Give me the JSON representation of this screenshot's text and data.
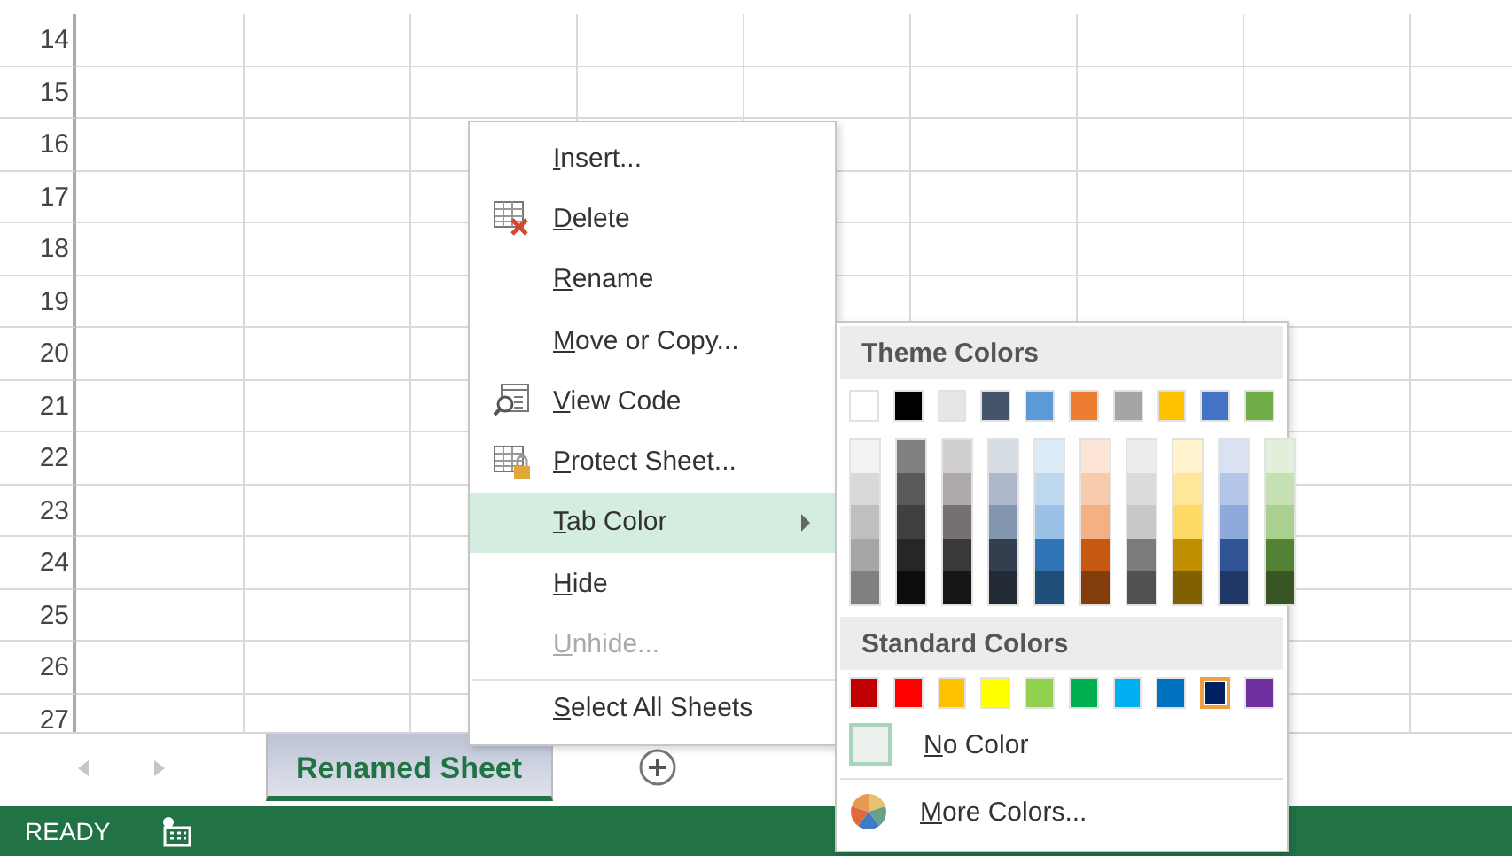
{
  "sheet": {
    "row_numbers": [
      "14",
      "15",
      "16",
      "17",
      "18",
      "19",
      "20",
      "21",
      "22",
      "23",
      "24",
      "25",
      "26",
      "27"
    ]
  },
  "context_menu": {
    "items": [
      {
        "label": "Insert...",
        "kind": "plain",
        "disabled": false,
        "selected": false,
        "separator_before": false
      },
      {
        "label": "Delete",
        "kind": "delete",
        "disabled": false,
        "selected": false,
        "separator_before": false
      },
      {
        "label": "Rename",
        "kind": "plain",
        "disabled": false,
        "selected": false,
        "separator_before": false
      },
      {
        "label": "Move or Copy...",
        "kind": "plain",
        "disabled": false,
        "selected": false,
        "separator_before": false
      },
      {
        "label": "View Code",
        "kind": "code",
        "disabled": false,
        "selected": false,
        "separator_before": false
      },
      {
        "label": "Protect Sheet...",
        "kind": "protect",
        "disabled": false,
        "selected": false,
        "separator_before": false
      },
      {
        "label": "Tab Color",
        "kind": "submenu",
        "disabled": false,
        "selected": true,
        "separator_before": false
      },
      {
        "label": "Hide",
        "kind": "plain",
        "disabled": false,
        "selected": false,
        "separator_before": false
      },
      {
        "label": "Unhide...",
        "kind": "plain",
        "disabled": true,
        "selected": false,
        "separator_before": false
      },
      {
        "label": "Select All Sheets",
        "kind": "plain",
        "disabled": false,
        "selected": false,
        "separator_before": true
      }
    ]
  },
  "color_menu": {
    "theme_title": "Theme Colors",
    "theme_colors": [
      {
        "color": "#ffffff",
        "shades": [
          {
            "color": "#f2f2f2"
          },
          {
            "color": "#d9d9d9"
          },
          {
            "color": "#bfbfbf"
          },
          {
            "color": "#a6a6a6"
          },
          {
            "color": "#808080"
          }
        ]
      },
      {
        "color": "#000000",
        "shades": [
          {
            "color": "#808080"
          },
          {
            "color": "#595959"
          },
          {
            "color": "#404040"
          },
          {
            "color": "#262626"
          },
          {
            "color": "#0d0d0d"
          }
        ]
      },
      {
        "color": "#e7e6e6",
        "shades": [
          {
            "color": "#d0cece"
          },
          {
            "color": "#aeaaaa"
          },
          {
            "color": "#757171"
          },
          {
            "color": "#3a3838"
          },
          {
            "color": "#171616"
          }
        ]
      },
      {
        "color": "#44546a",
        "shades": [
          {
            "color": "#d6dce4"
          },
          {
            "color": "#adb9ca"
          },
          {
            "color": "#8497b0"
          },
          {
            "color": "#333f4f"
          },
          {
            "color": "#222b35"
          }
        ]
      },
      {
        "color": "#5b9bd5",
        "shades": [
          {
            "color": "#ddebf7"
          },
          {
            "color": "#bdd7ee"
          },
          {
            "color": "#9bc2e6"
          },
          {
            "color": "#2f75b5"
          },
          {
            "color": "#1f4e78"
          }
        ]
      },
      {
        "color": "#ed7d31",
        "shades": [
          {
            "color": "#fce4d6"
          },
          {
            "color": "#f8cbad"
          },
          {
            "color": "#f4b084"
          },
          {
            "color": "#c65911"
          },
          {
            "color": "#833c0c"
          }
        ]
      },
      {
        "color": "#a5a5a5",
        "shades": [
          {
            "color": "#ededed"
          },
          {
            "color": "#dbdbdb"
          },
          {
            "color": "#c9c9c9"
          },
          {
            "color": "#7b7b7b"
          },
          {
            "color": "#525252"
          }
        ]
      },
      {
        "color": "#ffc000",
        "shades": [
          {
            "color": "#fff2cc"
          },
          {
            "color": "#ffe699"
          },
          {
            "color": "#ffd966"
          },
          {
            "color": "#bf8f00"
          },
          {
            "color": "#806000"
          }
        ]
      },
      {
        "color": "#4472c4",
        "shades": [
          {
            "color": "#d9e1f2"
          },
          {
            "color": "#b4c6e7"
          },
          {
            "color": "#8ea9db"
          },
          {
            "color": "#305496"
          },
          {
            "color": "#203764"
          }
        ]
      },
      {
        "color": "#70ad47",
        "shades": [
          {
            "color": "#e2efda"
          },
          {
            "color": "#c6e0b4"
          },
          {
            "color": "#a9d08e"
          },
          {
            "color": "#548235"
          },
          {
            "color": "#375623"
          }
        ]
      }
    ],
    "standard_title": "Standard Colors",
    "standard_colors": [
      {
        "color": "#c00000",
        "selected": false
      },
      {
        "color": "#ff0000",
        "selected": false
      },
      {
        "color": "#ffc000",
        "selected": false
      },
      {
        "color": "#ffff00",
        "selected": false
      },
      {
        "color": "#92d050",
        "selected": false
      },
      {
        "color": "#00b050",
        "selected": false
      },
      {
        "color": "#00b0f0",
        "selected": false
      },
      {
        "color": "#0070c0",
        "selected": false
      },
      {
        "color": "#002060",
        "selected": true
      },
      {
        "color": "#7030a0",
        "selected": false
      }
    ],
    "no_color": {
      "label": "No Color"
    },
    "more_colors": {
      "label": "More Colors..."
    }
  },
  "sheet_tabs": [
    {
      "label": "Renamed Sheet",
      "selected": true
    }
  ],
  "status_bar": {
    "text": "READY"
  }
}
